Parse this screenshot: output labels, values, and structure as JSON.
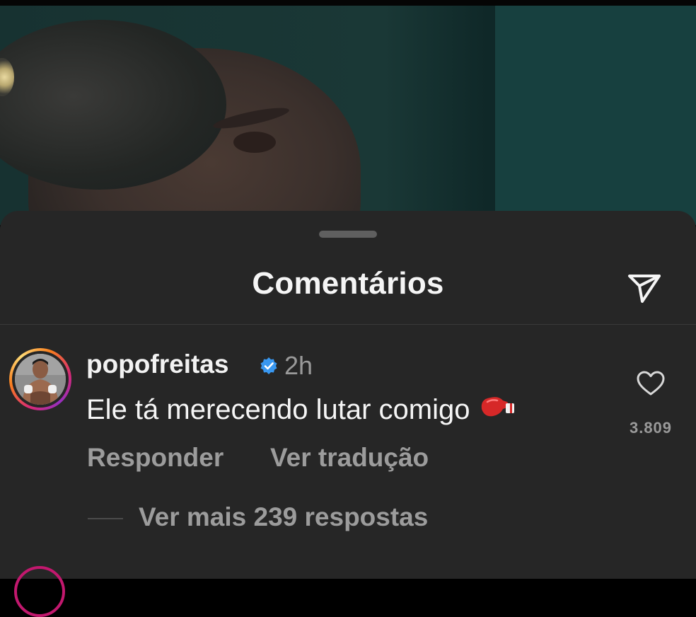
{
  "sheet": {
    "title": "Comentários"
  },
  "comment": {
    "username": "popofreitas",
    "time": "2h",
    "text": "Ele tá merecendo lutar comigo",
    "emoji": "boxing-glove",
    "likes": "3.809",
    "reply_label": "Responder",
    "translate_label": "Ver tradução",
    "more_replies_label": "Ver mais 239 respostas"
  },
  "colors": {
    "sheet_bg": "#262626",
    "verified_blue": "#3897f0",
    "muted_text": "#9c9c9c",
    "primary_text": "#f5f5f5"
  },
  "icons": [
    "share-icon",
    "verified-badge-icon",
    "heart-icon",
    "boxing-glove-icon"
  ]
}
